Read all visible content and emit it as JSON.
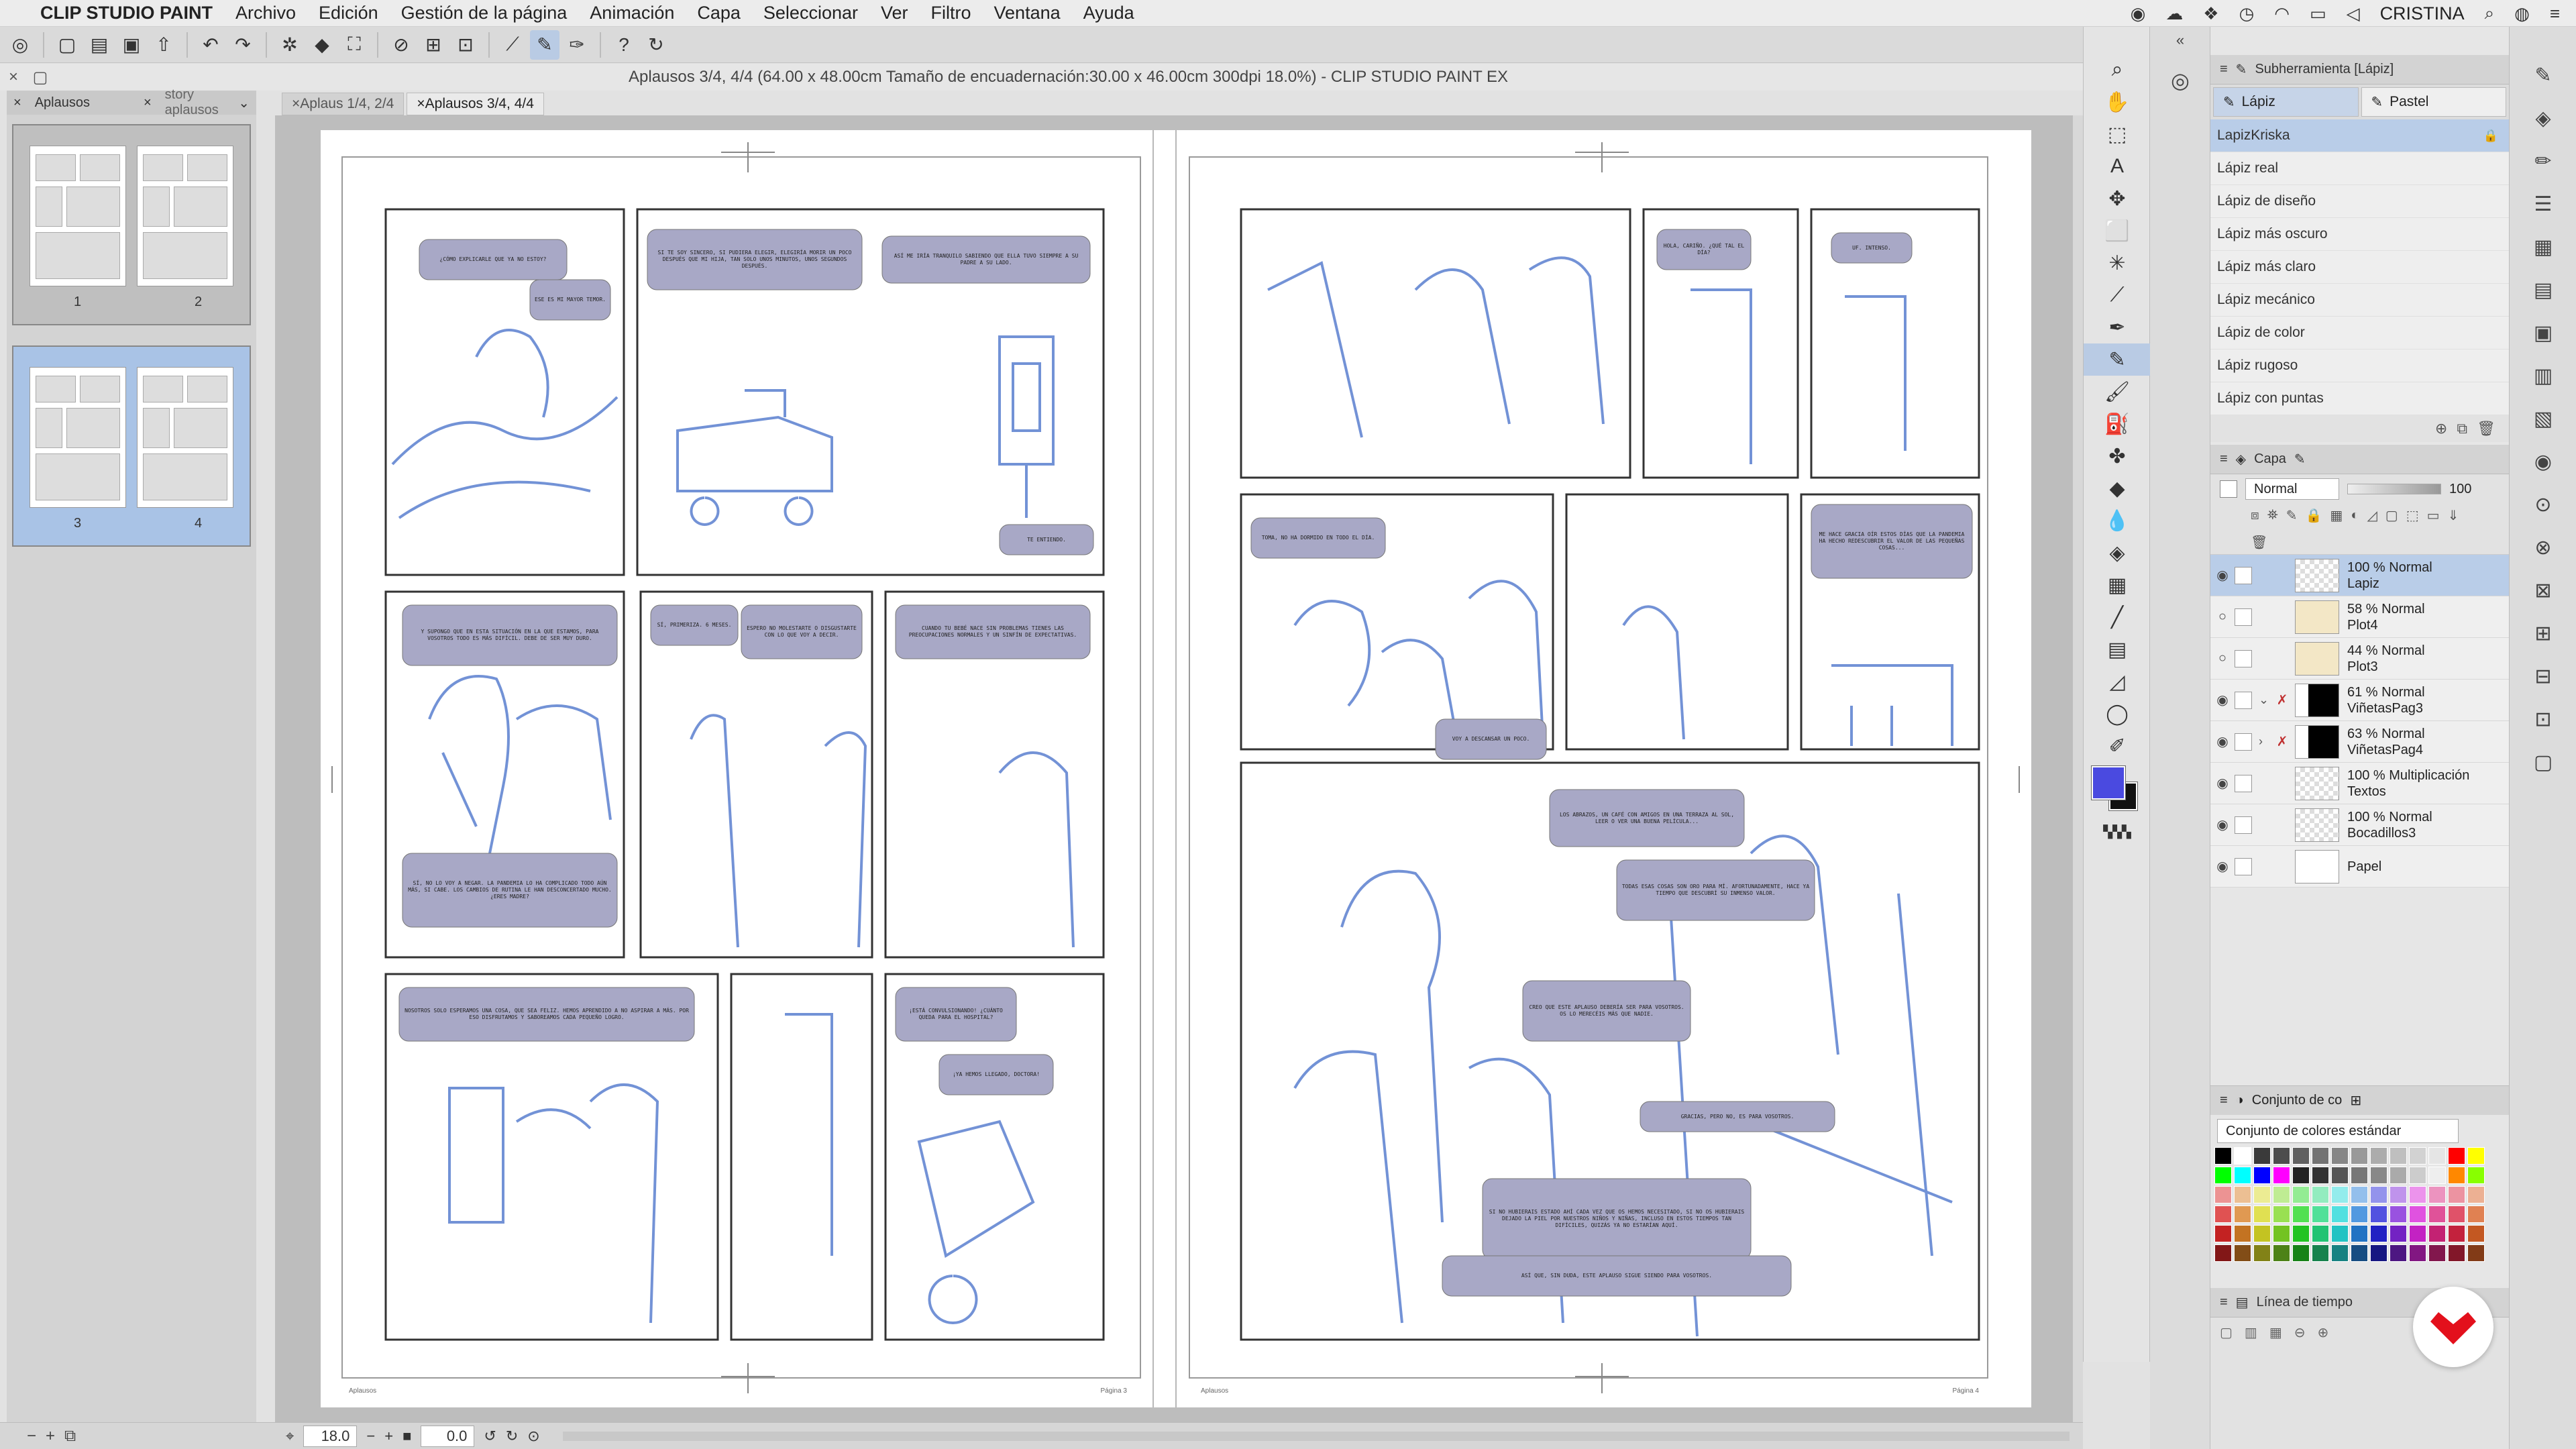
{
  "menubar": {
    "app_name": "CLIP STUDIO PAINT",
    "menus": [
      "Archivo",
      "Edición",
      "Gestión de la página",
      "Animación",
      "Capa",
      "Seleccionar",
      "Ver",
      "Filtro",
      "Ventana",
      "Ayuda"
    ],
    "user": "CRISTINA"
  },
  "window": {
    "title": "Aplausos 3/4, 4/4 (64.00 x 48.00cm Tamaño de encuadernación:30.00 x 46.00cm 300dpi 18.0%) - CLIP STUDIO PAINT EX"
  },
  "page_manager": {
    "tabs": [
      "Aplausos",
      "story aplausos"
    ],
    "spreads": [
      {
        "pages": [
          "1",
          "2"
        ],
        "selected": false
      },
      {
        "pages": [
          "3",
          "4"
        ],
        "selected": true
      }
    ]
  },
  "doc_tabs": [
    {
      "label": "Aplaus 1/4, 2/4",
      "active": false
    },
    {
      "label": "Aplausos 3/4, 4/4",
      "active": true
    }
  ],
  "canvas": {
    "footer_left": "Aplausos",
    "footer_right": "Página 3",
    "footer_left2": "Aplausos",
    "footer_right2": "Página 4",
    "balloons": [
      "¿CÓMO EXPLICARLE QUE YA NO ESTOY?",
      "ESE ES MI MAYOR TEMOR.",
      "SI TE SOY SINCERO, SI PUDIERA ELEGIR, ELEGIRÍA MORIR UN POCO DESPUÉS QUE MI HIJA, TAN SOLO UNOS MINUTOS, UNOS SEGUNDOS DESPUÉS.",
      "ASÍ ME IRÍA TRANQUILO SABIENDO QUE ELLA TUVO SIEMPRE A SU PADRE A SU LADO.",
      "TE ENTIENDO.",
      "Y SUPONGO QUE EN ESTA SITUACIÓN EN LA QUE ESTAMOS, PARA VOSOTROS TODO ES MÁS DIFÍCIL. DEBE DE SER MUY DURO.",
      "SÍ, PRIMERIZA. 6 MESES.",
      "ESPERO NO MOLESTARTE O DISGUSTARTE CON LO QUE VOY A DECIR.",
      "CUANDO TU BEBÉ NACE SIN PROBLEMAS TIENES LAS PREOCUPACIONES NORMALES Y UN SINFÍN DE EXPECTATIVAS.",
      "SÍ, NO LO VOY A NEGAR. LA PANDEMIA LO HA COMPLICADO TODO AÚN MÁS, SI CABE. LOS CAMBIOS DE RUTINA LE HAN DESCONCERTADO MUCHO. ¿ERES MADRE?",
      "NOSOTROS SOLO ESPERAMOS UNA COSA, QUE SEA FELIZ. HEMOS APRENDIDO A NO ASPIRAR A MÁS. POR ESO DISFRUTAMOS Y SABOREAMOS CADA PEQUEÑO LOGRO.",
      "¡ESTÁ CONVULSIONANDO! ¿CUÁNTO QUEDA PARA EL HOSPITAL?",
      "¡YA HEMOS LLEGADO, DOCTORA!",
      "HOLA, CARIÑO. ¿QUÉ TAL EL DÍA?",
      "UF. INTENSO.",
      "TOMA, NO HA DORMIDO EN TODO EL DÍA.",
      "VOY A DESCANSAR UN POCO.",
      "ME HACE GRACIA OÍR ESTOS DÍAS QUE LA PANDEMIA HA HECHO REDESCUBRIR EL VALOR DE LAS PEQUEÑAS COSAS...",
      "LOS ABRAZOS, UN CAFÉ CON AMIGOS EN UNA TERRAZA AL SOL, LEER O VER UNA BUENA PELÍCULA...",
      "TODAS ESAS COSAS SON ORO PARA MÍ. AFORTUNADAMENTE, HACE YA TIEMPO QUE DESCUBRÍ SU INMENSO VALOR.",
      "CREO QUE ESTE APLAUSO DEBERÍA SER PARA VOSOTROS. OS LO MERECÉIS MÁS QUE NADIE.",
      "GRACIAS, PERO NO, ES PARA VOSOTROS.",
      "SI NO HUBIERAIS ESTADO AHÍ CADA VEZ QUE OS HEMOS NECESITADO, SI NO OS HUBIERAIS DEJADO LA PIEL POR NUESTROS NIÑOS Y NIÑAS, INCLUSO EN ESTOS TIEMPOS TAN DIFÍCILES, QUIZÁS YA NO ESTARÍAN AQUÍ.",
      "ASÍ QUE, SIN DUDA, ESTE APLAUSO SIGUE SIENDO PARA VOSOTROS."
    ]
  },
  "statusbar": {
    "zoom": "18.0",
    "angle": "0.0"
  },
  "toolstrip": {
    "fg_color": "#4a4ae0",
    "bg_color": "#111111"
  },
  "subtool": {
    "title": "Subherramienta [Lápiz]",
    "tabs": [
      {
        "label": "Lápiz",
        "active": true
      },
      {
        "label": "Pastel",
        "active": false
      }
    ],
    "items": [
      {
        "label": "LapizKriska",
        "active": true,
        "locked": true
      },
      {
        "label": "Lápiz real",
        "active": false
      },
      {
        "label": "Lápiz de diseño",
        "active": false
      },
      {
        "label": "Lápiz más oscuro",
        "active": false
      },
      {
        "label": "Lápiz más claro",
        "active": false
      },
      {
        "label": "Lápiz mecánico",
        "active": false
      },
      {
        "label": "Lápiz de color",
        "active": false
      },
      {
        "label": "Lápiz rugoso",
        "active": false
      },
      {
        "label": "Lápiz con puntas",
        "active": false
      }
    ]
  },
  "layers": {
    "title": "Capa",
    "blend_mode": "Normal",
    "opacity": "100",
    "items": [
      {
        "mode": "100 % Normal",
        "name": "Lapiz",
        "thumb": "checker",
        "active": true,
        "visible": true,
        "expand": "",
        "badge": ""
      },
      {
        "mode": "58 % Normal",
        "name": "Plot4",
        "thumb": "sketch",
        "active": false,
        "visible": false,
        "expand": "",
        "badge": ""
      },
      {
        "mode": "44 % Normal",
        "name": "Plot3",
        "thumb": "sketch",
        "active": false,
        "visible": false,
        "expand": "",
        "badge": ""
      },
      {
        "mode": "61 % Normal",
        "name": "ViñetasPag3",
        "thumb": "black",
        "active": false,
        "visible": true,
        "expand": "⌄",
        "badge": "✗"
      },
      {
        "mode": "63 % Normal",
        "name": "ViñetasPag4",
        "thumb": "black",
        "active": false,
        "visible": true,
        "expand": "›",
        "badge": "✗"
      },
      {
        "mode": "100 % Multiplicación",
        "name": "Textos",
        "thumb": "checker",
        "active": false,
        "visible": true,
        "expand": "",
        "badge": ""
      },
      {
        "mode": "100 % Normal",
        "name": "Bocadillos3",
        "thumb": "checker",
        "active": false,
        "visible": true,
        "expand": "",
        "badge": ""
      },
      {
        "mode": "",
        "name": "Papel",
        "thumb": "white",
        "active": false,
        "visible": true,
        "expand": "",
        "badge": ""
      }
    ]
  },
  "palette": {
    "title": "Conjunto de co",
    "set_name": "Conjunto de colores estándar"
  },
  "timeline": {
    "title": "Línea de tiempo"
  }
}
